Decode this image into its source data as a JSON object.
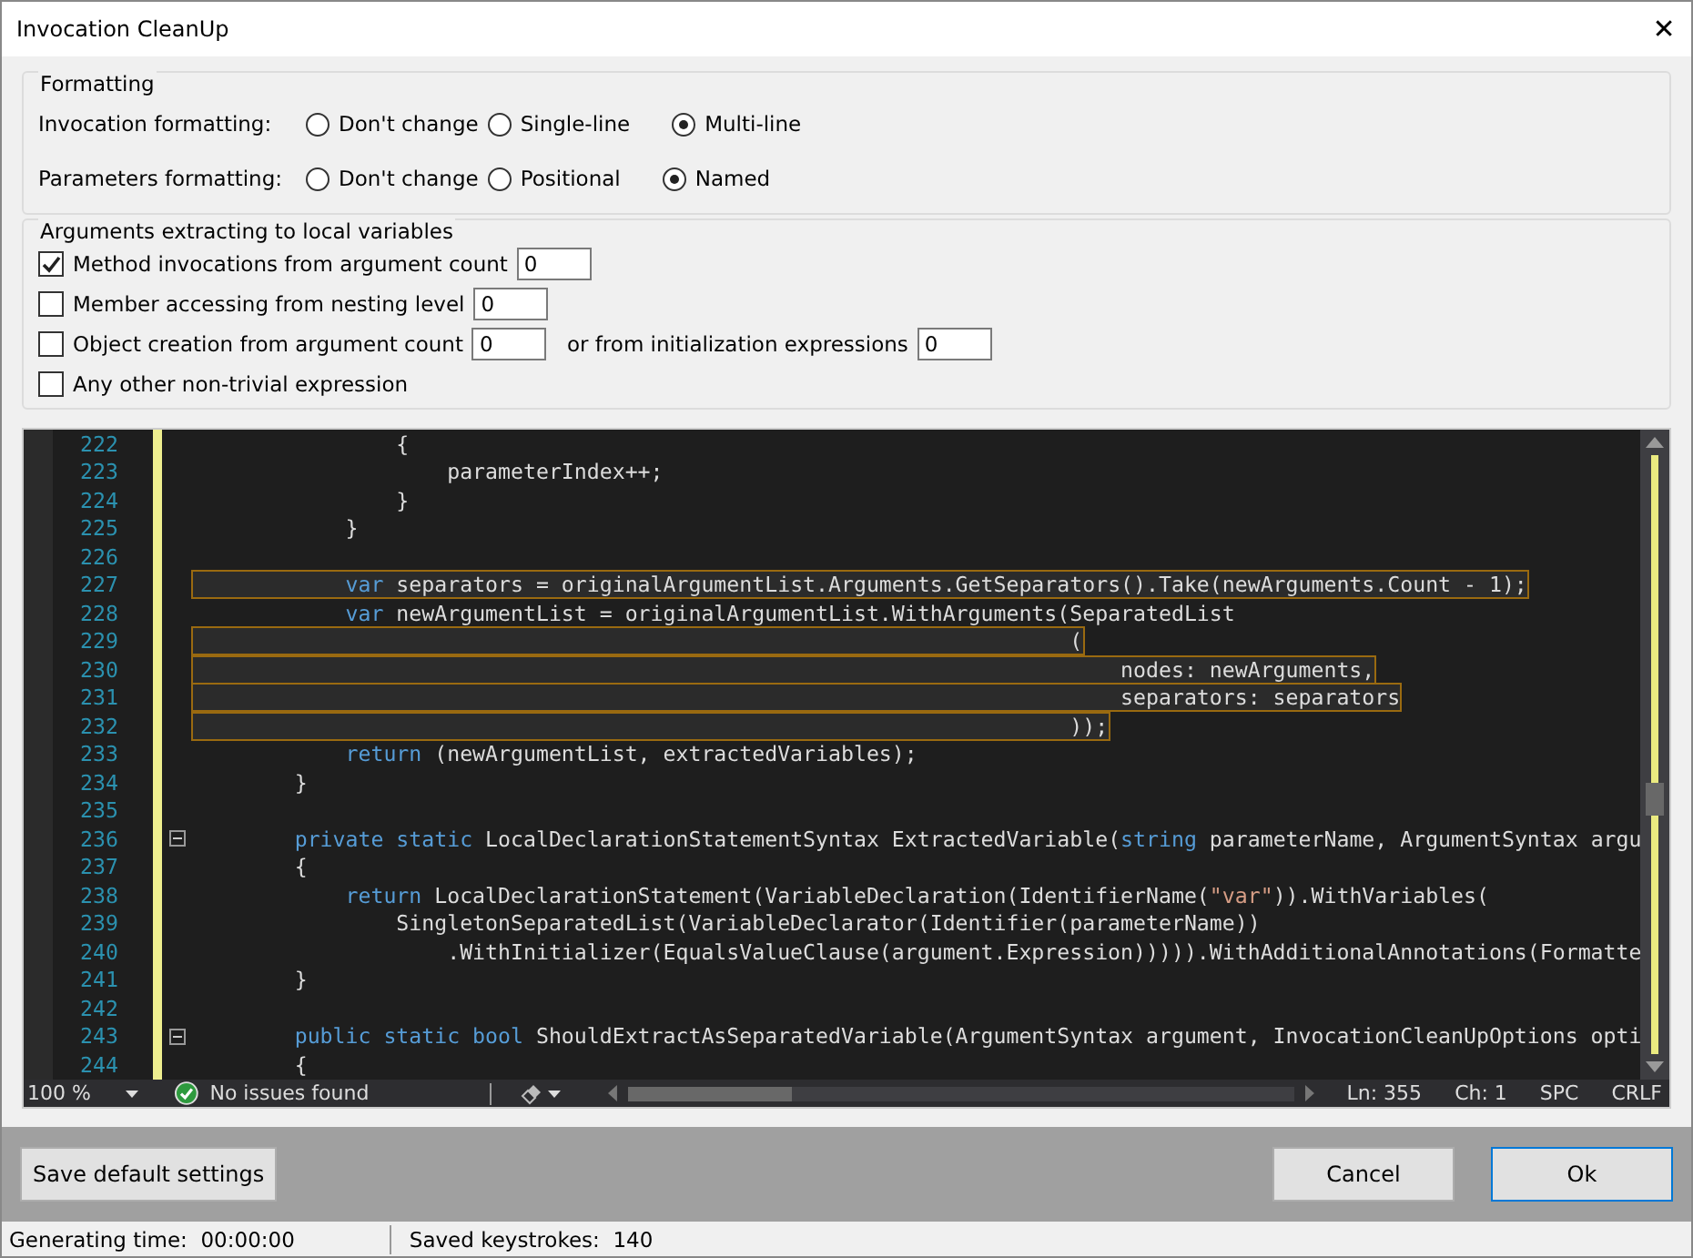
{
  "window": {
    "title": "Invocation CleanUp",
    "close": "✕"
  },
  "formatting": {
    "title": "Formatting",
    "rows": [
      {
        "label": "Invocation formatting:",
        "options": [
          {
            "label": "Don't change",
            "selected": false
          },
          {
            "label": "Single-line",
            "selected": false
          },
          {
            "label": "Multi-line",
            "selected": true
          }
        ]
      },
      {
        "label": "Parameters formatting:",
        "options": [
          {
            "label": "Don't change",
            "selected": false
          },
          {
            "label": "Positional",
            "selected": false
          },
          {
            "label": "Named",
            "selected": true
          }
        ]
      }
    ]
  },
  "extracting": {
    "title": "Arguments extracting to local variables",
    "options": [
      {
        "label": "Method invocations from argument count",
        "checked": true,
        "value": "0"
      },
      {
        "label": "Member accessing from nesting level",
        "checked": false,
        "value": "0"
      },
      {
        "label": "Object creation from argument count",
        "checked": false,
        "value": "0",
        "extra_label": "or from initialization expressions",
        "extra_value": "0"
      },
      {
        "label": "Any other non-trivial expression",
        "checked": false
      }
    ]
  },
  "editor": {
    "lines": [
      {
        "number": "222",
        "tokens": [
          {
            "kind": "plain",
            "t": "                {"
          }
        ]
      },
      {
        "number": "223",
        "tokens": [
          {
            "kind": "plain",
            "t": "                    parameterIndex++;"
          }
        ]
      },
      {
        "number": "224",
        "tokens": [
          {
            "kind": "plain",
            "t": "                }"
          }
        ]
      },
      {
        "number": "225",
        "tokens": [
          {
            "kind": "plain",
            "t": "            }"
          }
        ]
      },
      {
        "number": "226"
      },
      {
        "number": "227",
        "highlighted": true,
        "tokens": [
          {
            "kind": "kw",
            "t": "            var"
          },
          {
            "kind": "plain",
            "t": " separators = originalArgumentList.Arguments.GetSeparators().Take(newArguments.Count - 1);"
          }
        ]
      },
      {
        "number": "228",
        "tokens": [
          {
            "kind": "kw",
            "t": "            var"
          },
          {
            "kind": "plain",
            "t": " newArgumentList = originalArgumentList.WithArguments(SeparatedList"
          }
        ]
      },
      {
        "number": "229",
        "highlighted": true,
        "tokens": [
          {
            "kind": "plain",
            "t": "                                                                     ("
          }
        ]
      },
      {
        "number": "230",
        "highlighted": true,
        "tokens": [
          {
            "kind": "plain",
            "t": "                                                                         nodes: newArguments,"
          }
        ]
      },
      {
        "number": "231",
        "highlighted": true,
        "tokens": [
          {
            "kind": "plain",
            "t": "                                                                         separators: separators"
          }
        ]
      },
      {
        "number": "232",
        "highlighted": true,
        "tokens": [
          {
            "kind": "plain",
            "t": "                                                                     ));"
          }
        ]
      },
      {
        "number": "233",
        "tokens": [
          {
            "kind": "kw",
            "t": "            return"
          },
          {
            "kind": "plain",
            "t": " (newArgumentList, extractedVariables);"
          }
        ]
      },
      {
        "number": "234",
        "tokens": [
          {
            "kind": "plain",
            "t": "        }"
          }
        ]
      },
      {
        "number": "235"
      },
      {
        "number": "236",
        "fold": true,
        "tokens": [
          {
            "kind": "kw",
            "t": "        private static"
          },
          {
            "kind": "plain",
            "t": " LocalDeclarationStatementSyntax ExtractedVariable("
          },
          {
            "kind": "kw",
            "t": "string"
          },
          {
            "kind": "plain",
            "t": " parameterName, ArgumentSyntax argu"
          }
        ]
      },
      {
        "number": "237",
        "tokens": [
          {
            "kind": "plain",
            "t": "        {"
          }
        ]
      },
      {
        "number": "238",
        "tokens": [
          {
            "kind": "kw",
            "t": "            return"
          },
          {
            "kind": "plain",
            "t": " LocalDeclarationStatement(VariableDeclaration(IdentifierName("
          },
          {
            "kind": "str",
            "t": "\"var\""
          },
          {
            "kind": "plain",
            "t": ")).WithVariables("
          }
        ]
      },
      {
        "number": "239",
        "tokens": [
          {
            "kind": "plain",
            "t": "                SingletonSeparatedList(VariableDeclarator(Identifier(parameterName))"
          }
        ]
      },
      {
        "number": "240",
        "tokens": [
          {
            "kind": "plain",
            "t": "                    .WithInitializer(EqualsValueClause(argument.Expression))))).WithAdditionalAnnotations(Formatte"
          }
        ]
      },
      {
        "number": "241",
        "tokens": [
          {
            "kind": "plain",
            "t": "        }"
          }
        ]
      },
      {
        "number": "242"
      },
      {
        "number": "243",
        "fold": true,
        "tokens": [
          {
            "kind": "kw",
            "t": "        public static bool"
          },
          {
            "kind": "plain",
            "t": " ShouldExtractAsSeparatedVariable(ArgumentSyntax argument, InvocationCleanUpOptions opti"
          }
        ]
      },
      {
        "number": "244",
        "tokens": [
          {
            "kind": "plain",
            "t": "        {"
          }
        ]
      }
    ],
    "status": {
      "zoom": "100 %",
      "issues": "No issues found",
      "line": "Ln: 355",
      "column": "Ch: 1",
      "indent": "SPC",
      "line_ending": "CRLF"
    }
  },
  "buttons": {
    "save_defaults": "Save default settings",
    "cancel": "Cancel",
    "ok": "Ok"
  },
  "status_bar": [
    {
      "label": "Generating time:",
      "value": "00:00:00"
    },
    {
      "label": "Saved keystrokes:",
      "value": "140"
    }
  ]
}
